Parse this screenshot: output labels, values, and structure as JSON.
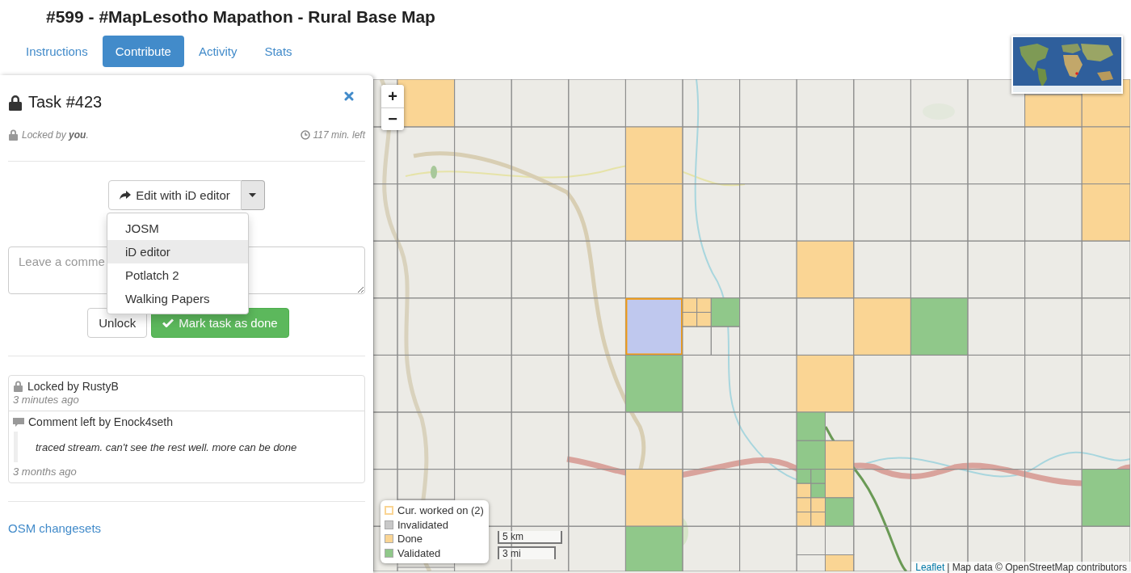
{
  "page_title": "#599 - #MapLesotho Mapathon - Rural Base Map",
  "tabs": [
    {
      "label": "Instructions",
      "selected": false
    },
    {
      "label": "Contribute",
      "selected": true
    },
    {
      "label": "Activity",
      "selected": false
    },
    {
      "label": "Stats",
      "selected": false
    }
  ],
  "task_panel": {
    "title": "Task #423",
    "lock_note": "Locked by **you**.",
    "time_left": "117 min. left",
    "editor_button": {
      "label": "Edit with iD editor"
    },
    "editor_menu": [
      {
        "label": "JOSM",
        "selected": false
      },
      {
        "label": "iD editor",
        "selected": true
      },
      {
        "label": "Potlatch 2",
        "selected": false
      },
      {
        "label": "Walking Papers",
        "selected": false
      }
    ],
    "comment_field": {
      "placeholder": "Leave a comme"
    },
    "buttons": [
      {
        "label": "Unlock",
        "kind": "default"
      },
      {
        "label": "Mark task as done",
        "kind": "success"
      }
    ],
    "history": [
      {
        "kind": "lock",
        "text": "Locked by RustyB",
        "time": "3 minutes ago"
      },
      {
        "kind": "comment",
        "text": "Comment left by Enock4seth",
        "quote": "traced stream. can't see the rest well. more can be done",
        "time": "3 months ago"
      }
    ],
    "link": "OSM changesets"
  },
  "map": {
    "zoom_controls": [
      "+",
      "−"
    ],
    "legend": [
      {
        "label": "Cur. worked on (2)",
        "kind": "current"
      },
      {
        "label": "Invalidated",
        "kind": "invalidated"
      },
      {
        "label": "Done",
        "kind": "done"
      },
      {
        "label": "Validated",
        "kind": "validated"
      }
    ],
    "scale": [
      "5 km",
      "3 mi"
    ],
    "attribution": {
      "link": "Leaflet",
      "text": "| Map data © OpenStreetMap contributors"
    },
    "task_grid": {
      "rows": [
        [
          {
            "kind": "ready"
          },
          {
            "kind": "done"
          },
          {
            "kind": "ready"
          },
          {
            "kind": "ready"
          },
          {
            "kind": "ready"
          },
          {
            "kind": "ready"
          },
          {
            "kind": "ready"
          },
          {
            "kind": "ready"
          },
          {
            "kind": "ready"
          },
          {
            "kind": "ready"
          },
          {
            "kind": "ready"
          },
          {
            "kind": "ready"
          },
          {
            "kind": "done"
          },
          {
            "kind": "done"
          }
        ],
        [
          {
            "kind": "ready"
          },
          {
            "kind": "ready"
          },
          {
            "kind": "ready"
          },
          {
            "kind": "ready"
          },
          {
            "kind": "ready"
          },
          {
            "kind": "done"
          },
          {
            "kind": "ready"
          },
          {
            "kind": "ready"
          },
          {
            "kind": "ready"
          },
          {
            "kind": "ready"
          },
          {
            "kind": "ready"
          },
          {
            "kind": "ready"
          },
          {
            "kind": "ready"
          },
          {
            "kind": "done"
          }
        ],
        [
          {
            "kind": "ready"
          },
          {
            "kind": "ready"
          },
          {
            "kind": "ready"
          },
          {
            "kind": "ready"
          },
          {
            "kind": "ready"
          },
          {
            "kind": "done"
          },
          {
            "kind": "ready"
          },
          {
            "kind": "ready"
          },
          {
            "kind": "ready"
          },
          {
            "kind": "ready"
          },
          {
            "kind": "ready"
          },
          {
            "kind": "ready"
          },
          {
            "kind": "ready"
          },
          {
            "kind": "done"
          }
        ],
        [
          {
            "kind": "ready"
          },
          {
            "kind": "ready"
          },
          {
            "kind": "ready"
          },
          {
            "kind": "ready"
          },
          {
            "kind": "ready"
          },
          {
            "kind": "ready"
          },
          {
            "kind": "ready"
          },
          {
            "kind": "ready"
          },
          {
            "kind": "done"
          },
          {
            "kind": "ready"
          },
          {
            "kind": "ready"
          },
          {
            "kind": "ready"
          },
          {
            "kind": "ready"
          },
          {
            "kind": "ready"
          }
        ],
        [
          {
            "kind": "ready"
          },
          {
            "kind": "ready"
          },
          {
            "kind": "ready"
          },
          {
            "kind": "ready"
          },
          {
            "kind": "ready"
          },
          {
            "kind": "current"
          },
          {
            "kind": "split",
            "children": [
              {
                "kind": "split",
                "children": [
                  {
                    "kind": "done"
                  },
                  {
                    "kind": "done"
                  },
                  {
                    "kind": "done"
                  },
                  {
                    "kind": "done"
                  }
                ]
              },
              {
                "kind": "validated"
              },
              {
                "kind": "ready"
              },
              {
                "kind": "ready"
              }
            ]
          },
          {
            "kind": "ready"
          },
          {
            "kind": "ready"
          },
          {
            "kind": "done"
          },
          {
            "kind": "validated"
          },
          {
            "kind": "ready"
          },
          {
            "kind": "ready"
          },
          {
            "kind": "ready"
          }
        ],
        [
          {
            "kind": "ready"
          },
          {
            "kind": "ready"
          },
          {
            "kind": "ready"
          },
          {
            "kind": "ready"
          },
          {
            "kind": "ready"
          },
          {
            "kind": "validated"
          },
          {
            "kind": "ready"
          },
          {
            "kind": "ready"
          },
          {
            "kind": "done"
          },
          {
            "kind": "ready"
          },
          {
            "kind": "ready"
          },
          {
            "kind": "ready"
          },
          {
            "kind": "ready"
          },
          {
            "kind": "ready"
          }
        ],
        [
          {
            "kind": "ready"
          },
          {
            "kind": "ready"
          },
          {
            "kind": "ready"
          },
          {
            "kind": "ready"
          },
          {
            "kind": "ready"
          },
          {
            "kind": "ready"
          },
          {
            "kind": "ready"
          },
          {
            "kind": "ready"
          },
          {
            "kind": "split",
            "children": [
              {
                "kind": "validated"
              },
              {
                "kind": "ready"
              },
              {
                "kind": "validated"
              },
              {
                "kind": "done"
              }
            ]
          },
          {
            "kind": "ready"
          },
          {
            "kind": "ready"
          },
          {
            "kind": "ready"
          },
          {
            "kind": "ready"
          },
          {
            "kind": "ready"
          }
        ],
        [
          {
            "kind": "ready"
          },
          {
            "kind": "ready"
          },
          {
            "kind": "ready"
          },
          {
            "kind": "ready"
          },
          {
            "kind": "ready"
          },
          {
            "kind": "done"
          },
          {
            "kind": "ready"
          },
          {
            "kind": "ready"
          },
          {
            "kind": "split",
            "children": [
              {
                "kind": "split",
                "children": [
                  {
                    "kind": "validated"
                  },
                  {
                    "kind": "validated"
                  },
                  {
                    "kind": "done"
                  },
                  {
                    "kind": "validated"
                  }
                ]
              },
              {
                "kind": "done"
              },
              {
                "kind": "split",
                "children": [
                  {
                    "kind": "done"
                  },
                  {
                    "kind": "done"
                  },
                  {
                    "kind": "done"
                  },
                  {
                    "kind": "done"
                  }
                ]
              },
              {
                "kind": "validated"
              }
            ]
          },
          {
            "kind": "ready"
          },
          {
            "kind": "ready"
          },
          {
            "kind": "ready"
          },
          {
            "kind": "ready"
          },
          {
            "kind": "validated"
          }
        ],
        [
          {
            "kind": "ready"
          },
          {
            "kind": "ready"
          },
          {
            "kind": "ready"
          },
          {
            "kind": "ready"
          },
          {
            "kind": "ready"
          },
          {
            "kind": "validated"
          },
          {
            "kind": "ready"
          },
          {
            "kind": "ready"
          },
          {
            "kind": "split",
            "children": [
              {
                "kind": "ready"
              },
              {
                "kind": "ready"
              },
              {
                "kind": "ready"
              },
              {
                "kind": "done"
              }
            ]
          },
          {
            "kind": "ready"
          },
          {
            "kind": "ready"
          },
          {
            "kind": "ready"
          },
          {
            "kind": "ready"
          },
          {
            "kind": "ready"
          }
        ]
      ]
    }
  }
}
